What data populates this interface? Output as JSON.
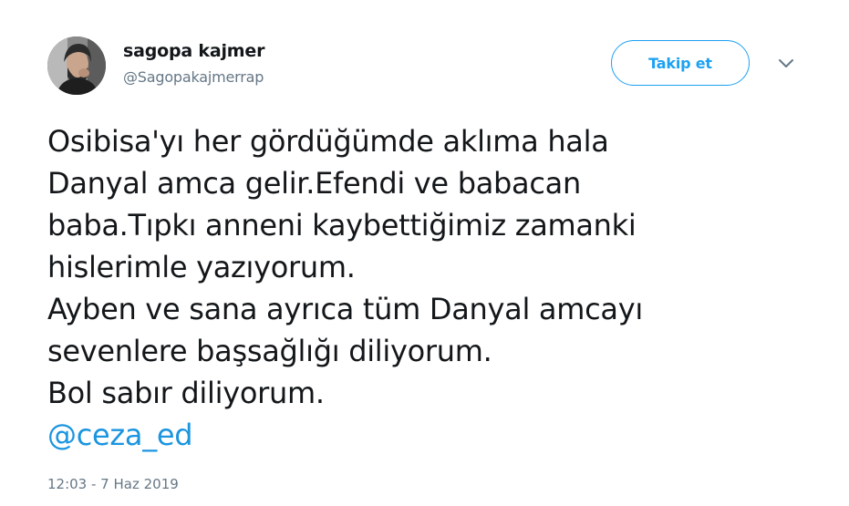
{
  "user": {
    "display_name": "sagopa kajmer",
    "handle": "@Sagopakajmerrap",
    "avatar_icon": "profile-photo"
  },
  "follow_button": {
    "label": "Takip et"
  },
  "caret_icon": "chevron-down-icon",
  "tweet": {
    "lines": [
      "Osibisa'yı her gördüğümde aklıma hala",
      "Danyal amca gelir.Efendi ve babacan",
      "baba.Tıpkı anneni kaybettiğimiz zamanki",
      "hislerimle yazıyorum.",
      "Ayben ve sana ayrıca tüm Danyal amcayı",
      "sevenlere başsağlığı diliyorum.",
      "Bol sabır diliyorum."
    ],
    "mention": "@ceza_ed",
    "timestamp": "12:03 - 7 Haz 2019"
  },
  "colors": {
    "accent": "#1da1f2",
    "mention": "#1b95e0",
    "secondary_text": "#657786",
    "primary_text": "#14171a"
  }
}
